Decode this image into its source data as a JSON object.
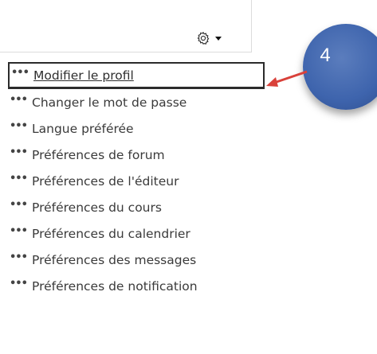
{
  "menu": {
    "items": [
      {
        "label": "Modifier le profil",
        "active": true
      },
      {
        "label": "Changer le mot de passe"
      },
      {
        "label": "Langue préférée"
      },
      {
        "label": "Préférences de forum"
      },
      {
        "label": "Préférences de l'éditeur"
      },
      {
        "label": "Préférences du cours"
      },
      {
        "label": "Préférences du calendrier"
      },
      {
        "label": "Préférences des messages"
      },
      {
        "label": "Préférences de notification"
      }
    ]
  },
  "annotation": {
    "step_number": "4",
    "badge_color": "#4169b0",
    "arrow_color": "#d9413a"
  },
  "icons": {
    "settings": "gear-icon",
    "dropdown": "caret-down-icon",
    "bullet": "more-dots-icon"
  }
}
